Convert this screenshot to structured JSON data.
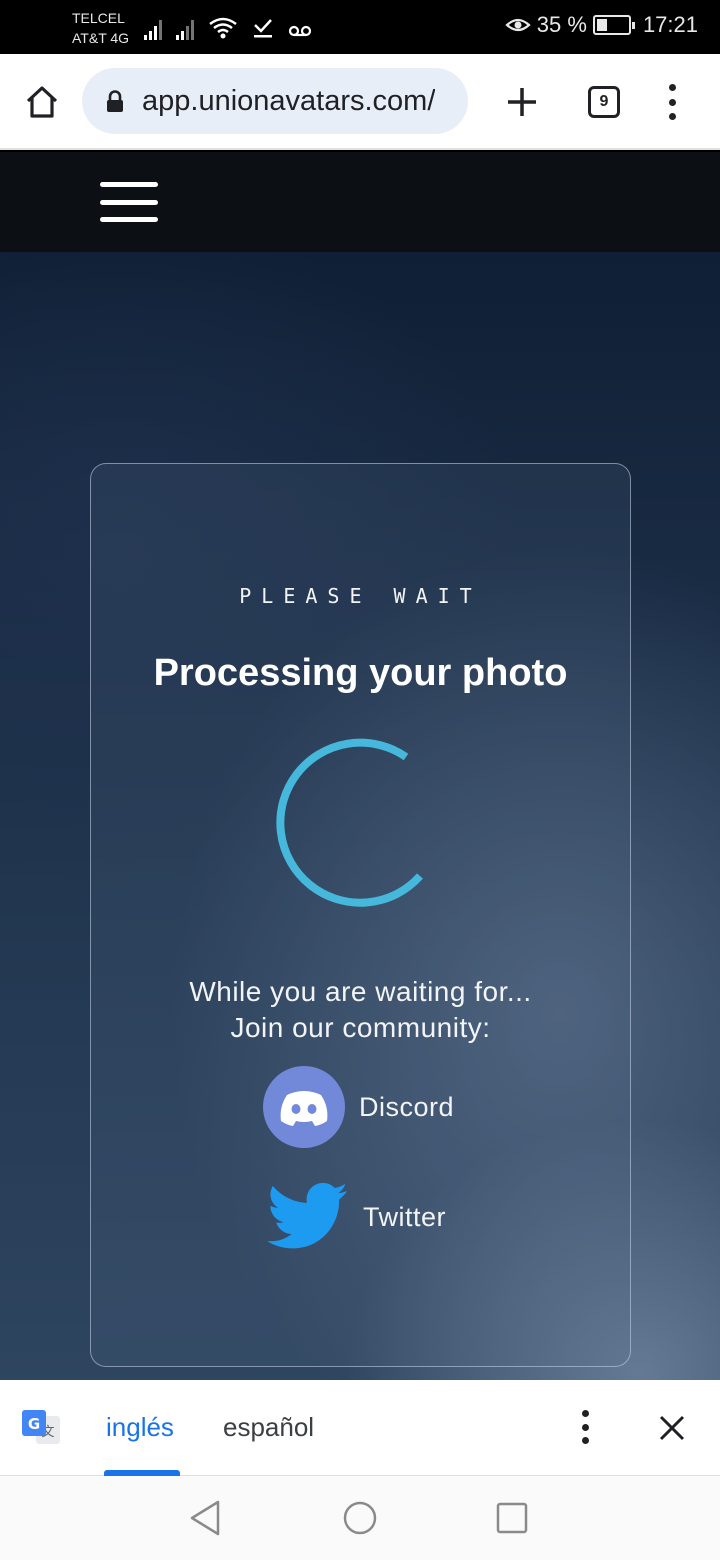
{
  "status_bar": {
    "carrier_1": "TELCEL",
    "carrier_2": "AT&T 4G",
    "battery": "35 %",
    "battery_level": 0.35,
    "time": "17:21"
  },
  "browser": {
    "url": "app.unionavatars.com/",
    "tab_count": "9"
  },
  "card": {
    "eyebrow": "PLEASE WAIT",
    "title": "Processing your photo",
    "wait_line_1": "While you are waiting for...",
    "wait_line_2": "Join our community:",
    "discord_label": "Discord",
    "twitter_label": "Twitter"
  },
  "translate_bar": {
    "lang_source": "inglés",
    "lang_target": "español"
  },
  "colors": {
    "spinner": "#45b8dc",
    "discord": "#7289da",
    "twitter": "#1d9bf0",
    "translate_accent": "#1a73e8"
  }
}
